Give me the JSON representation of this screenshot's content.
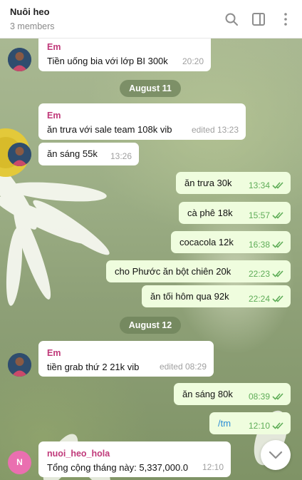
{
  "header": {
    "title": "Nuôi heo",
    "subtitle": "3 members"
  },
  "icons": {
    "search": "search-icon",
    "sidebar": "sidebar-toggle-icon",
    "menu": "more-vertical-icon"
  },
  "dates": {
    "aug11": "August 11",
    "aug12": "August 12"
  },
  "messages": {
    "m1": {
      "sender": "Em",
      "text": "Tiền uống bia với lớp BI 300k",
      "time": "20:20"
    },
    "m2": {
      "sender": "Em",
      "text": "ăn trưa với sale team 108k vib",
      "time": "edited 13:23"
    },
    "m3": {
      "text": "ăn sáng 55k",
      "time": "13:26"
    },
    "m4": {
      "text": "ăn trưa 30k",
      "time": "13:34"
    },
    "m5": {
      "text": "cà phê 18k",
      "time": "15:57"
    },
    "m6": {
      "text": "cocacola 12k",
      "time": "16:38"
    },
    "m7": {
      "text": "cho Phước ăn bột chiên 20k",
      "time": "22:23"
    },
    "m8": {
      "text": "ăn tối hôm qua 92k",
      "time": "22:24"
    },
    "m9": {
      "sender": "Em",
      "text": "tiền grab thứ 2 21k vib",
      "time": "edited 08:29"
    },
    "m10": {
      "text": "ăn sáng 80k",
      "time": "08:39"
    },
    "m11": {
      "text": "/tm",
      "time": "12:10"
    },
    "m12": {
      "sender": "nuoi_heo_hola",
      "text": "Tổng cộng tháng này: 5,337,000.0",
      "time": "12:10",
      "avatar_letter": "N"
    }
  },
  "colors": {
    "sender_em": "#c0397a",
    "sender_bot": "#c0397a",
    "outgoing_bubble": "#effdde",
    "tick": "#5fad58",
    "link": "#2a8dd6"
  }
}
